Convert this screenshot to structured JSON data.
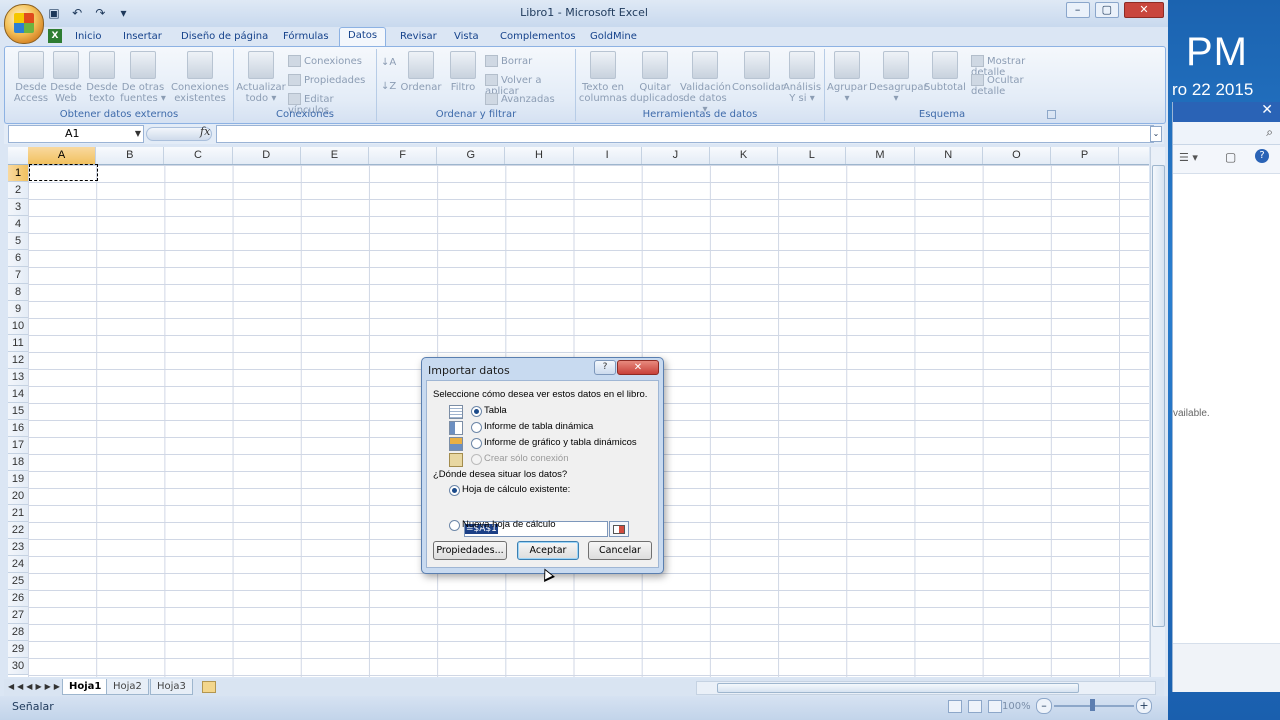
{
  "desktop": {
    "clock_time": "PM",
    "clock_date": "ro 22 2015",
    "side_text": "vailable."
  },
  "window": {
    "title": "Libro1 - Microsoft Excel"
  },
  "tabs": [
    {
      "label": "Inicio"
    },
    {
      "label": "Insertar"
    },
    {
      "label": "Diseño de página"
    },
    {
      "label": "Fórmulas"
    },
    {
      "label": "Datos"
    },
    {
      "label": "Revisar"
    },
    {
      "label": "Vista"
    },
    {
      "label": "Complementos"
    },
    {
      "label": "GoldMine"
    }
  ],
  "active_tab": "Datos",
  "ribbon": {
    "groups": [
      {
        "label": "Obtener datos externos",
        "buttons": [
          {
            "line1": "Desde",
            "line2": "Access"
          },
          {
            "line1": "Desde",
            "line2": "Web"
          },
          {
            "line1": "Desde",
            "line2": "texto"
          },
          {
            "line1": "De otras",
            "line2": "fuentes ▾"
          },
          {
            "line1": "Conexiones",
            "line2": "existentes"
          }
        ]
      },
      {
        "label": "Conexiones",
        "buttons": [
          {
            "line1": "Actualizar",
            "line2": "todo ▾"
          }
        ],
        "small": [
          "Conexiones",
          "Propiedades",
          "Editar vínculos"
        ]
      },
      {
        "label": "Ordenar y filtrar",
        "buttons": [
          {
            "line1": "Ordenar",
            "line2": ""
          },
          {
            "line1": "Filtro",
            "line2": ""
          }
        ],
        "small": [
          "Borrar",
          "Volver a aplicar",
          "Avanzadas"
        ]
      },
      {
        "label": "Herramientas de datos",
        "buttons": [
          {
            "line1": "Texto en",
            "line2": "columnas"
          },
          {
            "line1": "Quitar",
            "line2": "duplicados"
          },
          {
            "line1": "Validación",
            "line2": "de datos ▾"
          },
          {
            "line1": "Consolidar",
            "line2": ""
          },
          {
            "line1": "Análisis",
            "line2": "Y si ▾"
          }
        ]
      },
      {
        "label": "Esquema",
        "buttons": [
          {
            "line1": "Agrupar",
            "line2": "▾"
          },
          {
            "line1": "Desagrupar",
            "line2": "▾"
          },
          {
            "line1": "Subtotal",
            "line2": ""
          }
        ],
        "small": [
          "Mostrar detalle",
          "Ocultar detalle"
        ]
      }
    ]
  },
  "formula_bar": {
    "name_box": "A1",
    "fx": "fx",
    "value": ""
  },
  "grid": {
    "columns": [
      "A",
      "B",
      "C",
      "D",
      "E",
      "F",
      "G",
      "H",
      "I",
      "J",
      "K",
      "L",
      "M",
      "N",
      "O",
      "P"
    ],
    "rows": [
      "1",
      "2",
      "3",
      "4",
      "5",
      "6",
      "7",
      "8",
      "9",
      "10",
      "11",
      "12",
      "13",
      "14",
      "15",
      "16",
      "17",
      "18",
      "19",
      "20",
      "21",
      "22",
      "23",
      "24",
      "25",
      "26",
      "27",
      "28",
      "29",
      "30"
    ],
    "active_cell": "A1"
  },
  "sheets": [
    {
      "label": "Hoja1",
      "active": true
    },
    {
      "label": "Hoja2",
      "active": false
    },
    {
      "label": "Hoja3",
      "active": false
    }
  ],
  "status": {
    "mode": "Señalar",
    "zoom": "100%"
  },
  "dialog": {
    "title": "Importar datos",
    "prompt_view": "Seleccione cómo desea ver estos datos en el libro.",
    "view_options": [
      {
        "label": "Tabla",
        "checked": true,
        "enabled": true
      },
      {
        "label": "Informe de tabla dinámica",
        "checked": false,
        "enabled": true
      },
      {
        "label": "Informe de gráfico y tabla dinámicos",
        "checked": false,
        "enabled": true
      },
      {
        "label": "Crear sólo conexión",
        "checked": false,
        "enabled": false
      }
    ],
    "prompt_location": "¿Dónde desea situar los datos?",
    "location_options": [
      {
        "label": "Hoja de cálculo existente:",
        "checked": true
      },
      {
        "label": "Nueva hoja de cálculo",
        "checked": false
      }
    ],
    "location_value": "=$A$1",
    "buttons": {
      "properties": "Propiedades...",
      "ok": "Aceptar",
      "cancel": "Cancelar"
    },
    "help_label": "?",
    "close_label": "✕"
  },
  "colors": {
    "accent": "#15428b",
    "close_red": "#c8413a"
  }
}
